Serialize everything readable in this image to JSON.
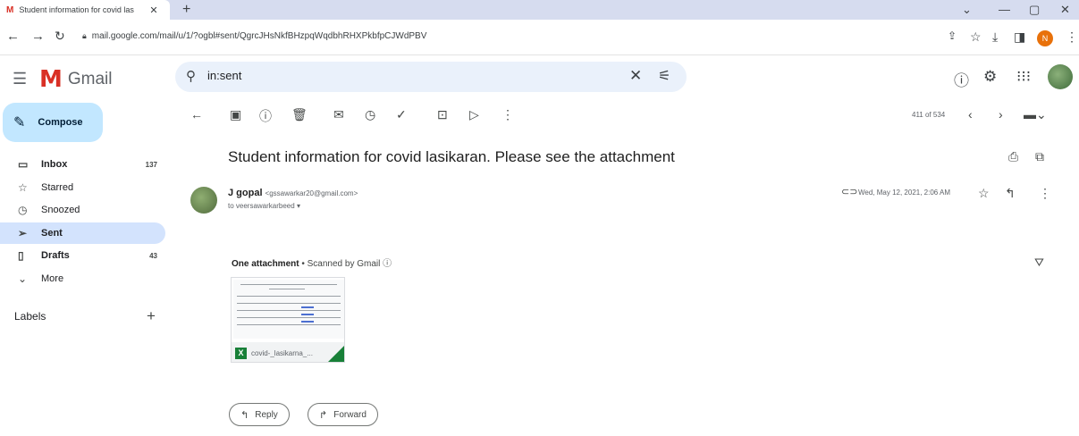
{
  "browser": {
    "tab_title": "Student information for covid las",
    "url": "mail.google.com/mail/u/1/?ogbl#sent/QgrcJHsNkfBHzpqWqdbhRHXPkbfpCJWdPBV",
    "profile_initial": "N"
  },
  "header": {
    "app_name": "Gmail",
    "search_value": "in:sent"
  },
  "sidebar": {
    "compose_label": "Compose",
    "items": [
      {
        "label": "Inbox",
        "count": "137"
      },
      {
        "label": "Starred",
        "count": ""
      },
      {
        "label": "Snoozed",
        "count": ""
      },
      {
        "label": "Sent",
        "count": ""
      },
      {
        "label": "Drafts",
        "count": "43"
      },
      {
        "label": "More",
        "count": ""
      }
    ],
    "labels_heading": "Labels"
  },
  "toolbar": {
    "pager": "411 of 534"
  },
  "message": {
    "subject": "Student information for covid lasikaran. Please see the attachment",
    "sender_name": "J gopal",
    "sender_email": "<gssawarkar20@gmail.com>",
    "recipient": "to veersawarkarbeed",
    "date": "Wed, May 12, 2021, 2:06 AM",
    "attachment_header": "One attachment",
    "scanned_text": "Scanned by Gmail",
    "attachment_name": "covid-_lasikarna_..."
  },
  "actions": {
    "reply": "Reply",
    "forward": "Forward"
  }
}
